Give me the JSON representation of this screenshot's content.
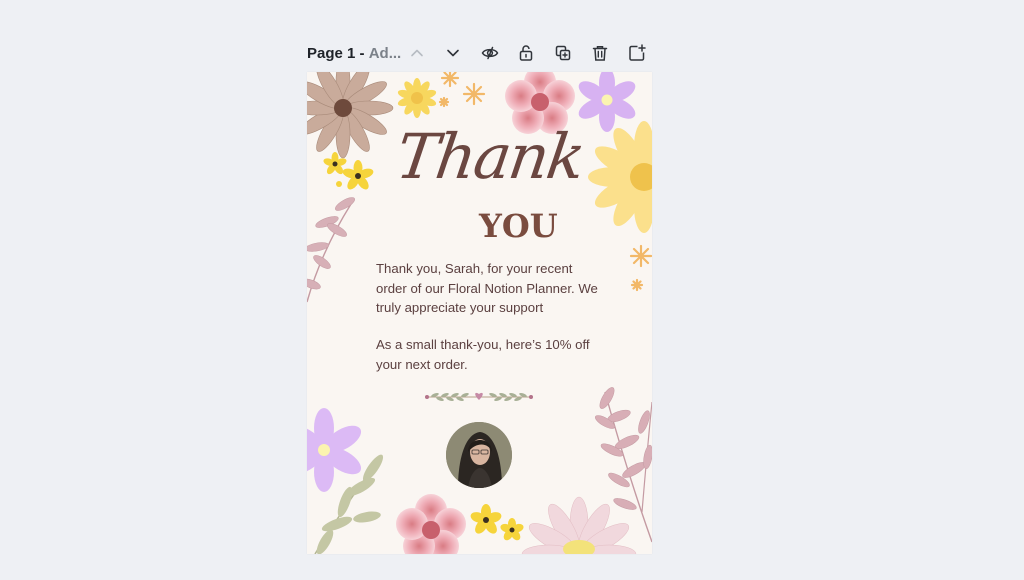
{
  "toolbar": {
    "page_number": "Page 1 -",
    "page_name": "Ad...",
    "icons": [
      "chevron-up-icon",
      "chevron-down-icon",
      "eye-icon",
      "unlock-icon",
      "duplicate-icon",
      "trash-icon",
      "add-page-icon"
    ]
  },
  "card": {
    "title_thank": "Thank",
    "title_you": "YOU",
    "message1": "Thank you, Sarah, for your recent order of our Floral Notion Planner. We truly appreciate your support",
    "message2": "As a small thank-you, here’s 10% off your next order."
  },
  "colors": {
    "background": "#eef0f4",
    "card": "#faf6f2",
    "title": "#6b4741",
    "text": "#5b4040"
  }
}
